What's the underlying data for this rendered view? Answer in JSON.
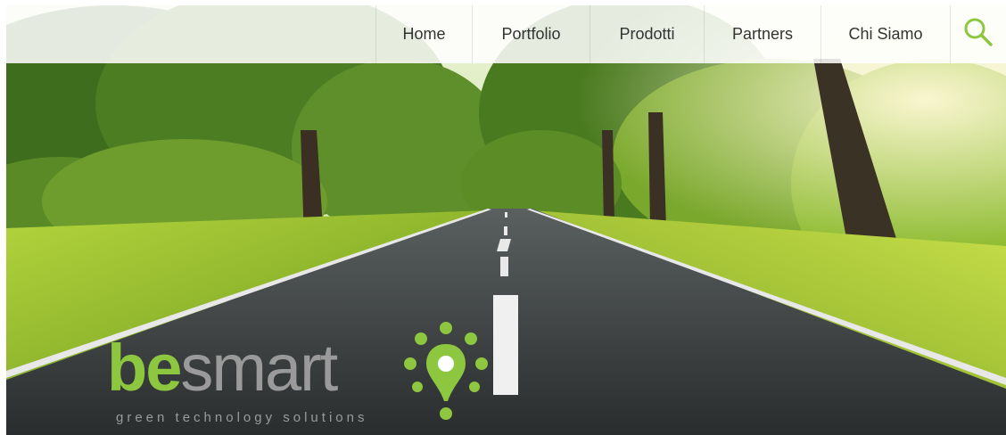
{
  "nav": {
    "items": [
      {
        "label": "Home"
      },
      {
        "label": "Portfolio"
      },
      {
        "label": "Prodotti"
      },
      {
        "label": "Partners"
      },
      {
        "label": "Chi Siamo"
      }
    ],
    "search_icon": "search-icon"
  },
  "logo": {
    "word_green": "be",
    "word_grey": "smart",
    "tagline": "green technology solutions",
    "mark_icon": "map-pin-lightbulb-icon"
  },
  "colors": {
    "brand_green": "#8dc63f",
    "logo_grey": "#9a9a9a",
    "nav_text": "#333333",
    "search_icon": "#8dc63f"
  }
}
